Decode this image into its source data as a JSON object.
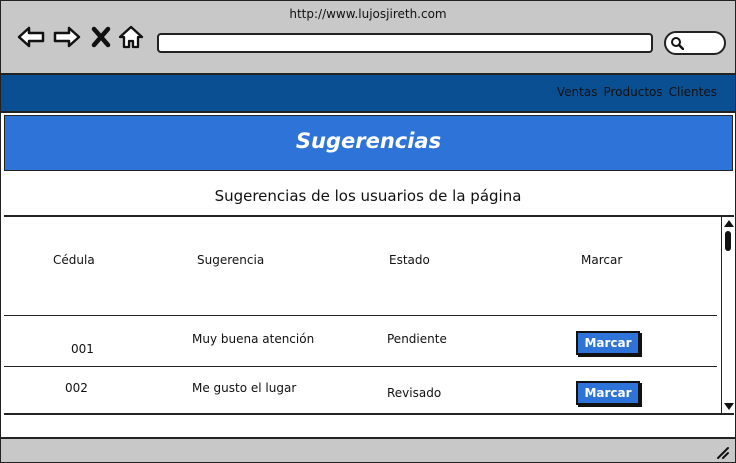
{
  "browser": {
    "url": "http://www.lujosjireth.com",
    "icons": [
      "back-arrow-icon",
      "forward-arrow-icon",
      "close-icon",
      "home-icon",
      "search-icon"
    ]
  },
  "nav": {
    "links": [
      "Ventas",
      "Productos",
      "Clientes"
    ]
  },
  "page": {
    "title": "Sugerencias",
    "subtitle": "Sugerencias de los usuarios de la página"
  },
  "table": {
    "headers": [
      "Cédula",
      "Sugerencia",
      "Estado",
      "Marcar"
    ],
    "rows": [
      {
        "cedula": "001",
        "sugerencia": "Muy buena atención",
        "estado": "Pendiente",
        "action": "Marcar"
      },
      {
        "cedula": "002",
        "sugerencia": "Me gusto el lugar",
        "estado": "Revisado",
        "action": "Marcar"
      }
    ]
  },
  "colors": {
    "chrome": "#c8c8c8",
    "nav_bar": "#0a4f92",
    "banner": "#2e74d8",
    "button": "#2e74d8"
  }
}
